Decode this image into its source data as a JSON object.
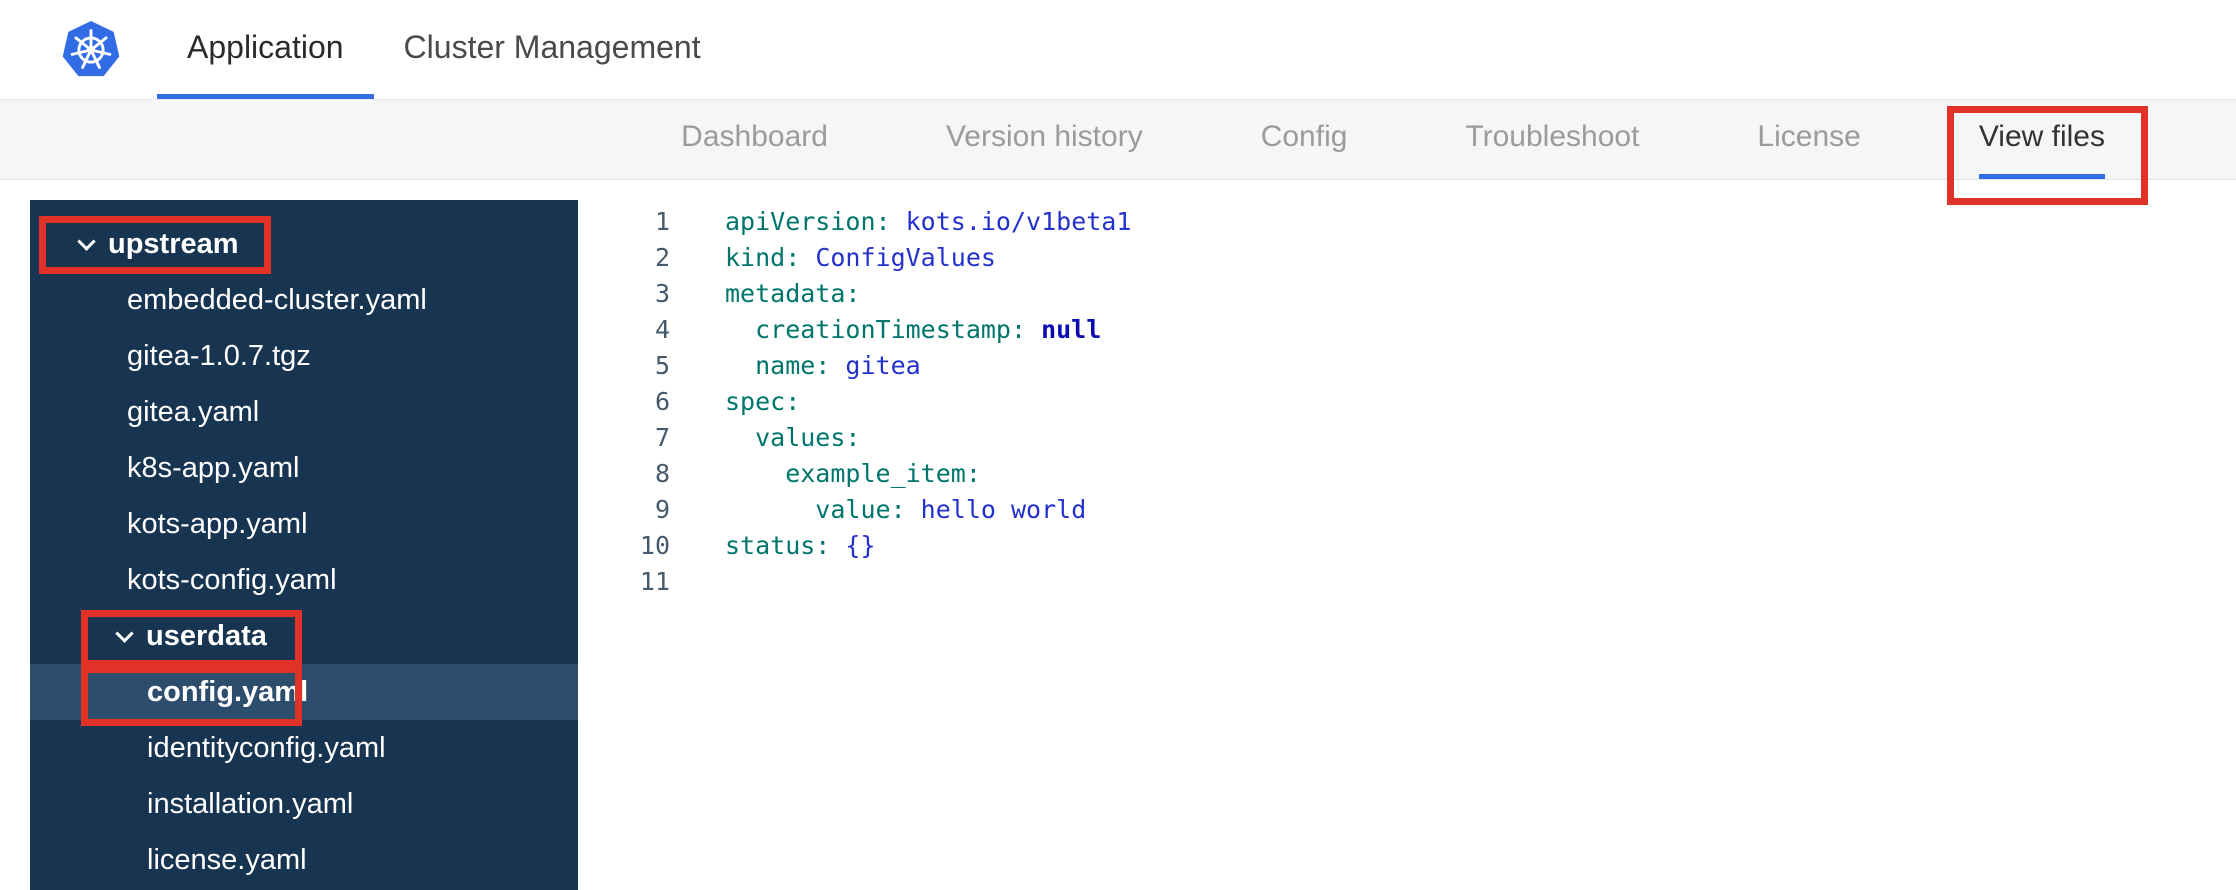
{
  "header": {
    "tabs": [
      {
        "label": "Application",
        "active": true
      },
      {
        "label": "Cluster Management",
        "active": false
      }
    ]
  },
  "subnav": {
    "tabs": [
      {
        "label": "Dashboard",
        "active": false
      },
      {
        "label": "Version history",
        "active": false
      },
      {
        "label": "Config",
        "active": false
      },
      {
        "label": "Troubleshoot",
        "active": false
      },
      {
        "label": "License",
        "active": false
      },
      {
        "label": "View files",
        "active": true,
        "annotated": true
      }
    ]
  },
  "file_tree": {
    "items": [
      {
        "type": "folder",
        "label": "upstream",
        "level": 0,
        "expanded": true,
        "annotated": true
      },
      {
        "type": "file",
        "label": "embedded-cluster.yaml",
        "level": 1
      },
      {
        "type": "file",
        "label": "gitea-1.0.7.tgz",
        "level": 1
      },
      {
        "type": "file",
        "label": "gitea.yaml",
        "level": 1
      },
      {
        "type": "file",
        "label": "k8s-app.yaml",
        "level": 1
      },
      {
        "type": "file",
        "label": "kots-app.yaml",
        "level": 1
      },
      {
        "type": "file",
        "label": "kots-config.yaml",
        "level": 1
      },
      {
        "type": "folder",
        "label": "userdata",
        "level": 1,
        "expanded": true,
        "annotated": true
      },
      {
        "type": "file",
        "label": "config.yaml",
        "level": 2,
        "selected": true,
        "annotated": true
      },
      {
        "type": "file",
        "label": "identityconfig.yaml",
        "level": 2
      },
      {
        "type": "file",
        "label": "installation.yaml",
        "level": 2
      },
      {
        "type": "file",
        "label": "license.yaml",
        "level": 2
      }
    ]
  },
  "editor": {
    "lines": [
      {
        "n": "1",
        "tokens": [
          {
            "c": "key",
            "t": "apiVersion:"
          },
          {
            "c": "val",
            "t": " kots.io/v1beta1"
          }
        ]
      },
      {
        "n": "2",
        "tokens": [
          {
            "c": "key",
            "t": "kind:"
          },
          {
            "c": "val",
            "t": " ConfigValues"
          }
        ]
      },
      {
        "n": "3",
        "tokens": [
          {
            "c": "key",
            "t": "metadata:"
          }
        ]
      },
      {
        "n": "4",
        "tokens": [
          {
            "c": "key",
            "t": "  creationTimestamp:"
          },
          {
            "c": "val-bold",
            "t": " null"
          }
        ]
      },
      {
        "n": "5",
        "tokens": [
          {
            "c": "key",
            "t": "  name:"
          },
          {
            "c": "val",
            "t": " gitea"
          }
        ]
      },
      {
        "n": "6",
        "tokens": [
          {
            "c": "key",
            "t": "spec:"
          }
        ]
      },
      {
        "n": "7",
        "tokens": [
          {
            "c": "key",
            "t": "  values:"
          }
        ]
      },
      {
        "n": "8",
        "tokens": [
          {
            "c": "key",
            "t": "    example_item:"
          }
        ]
      },
      {
        "n": "9",
        "tokens": [
          {
            "c": "key",
            "t": "      value:"
          },
          {
            "c": "val",
            "t": " hello world"
          }
        ]
      },
      {
        "n": "10",
        "tokens": [
          {
            "c": "key",
            "t": "status:"
          },
          {
            "c": "val",
            "t": " {}"
          }
        ]
      },
      {
        "n": "11",
        "tokens": []
      }
    ]
  },
  "annotations": {
    "color": "#e03226",
    "boxes": [
      "view-files-tab",
      "upstream-folder",
      "userdata-folder",
      "config-yaml-file"
    ]
  },
  "colors": {
    "accent_blue": "#326de6",
    "annotation_red": "#e03226",
    "sidebar_bg": "#173450",
    "sidebar_selected": "#2d4d6d",
    "code_key": "#00756b",
    "code_value": "#2431cc",
    "code_null": "#0b0bb3",
    "line_number": "#44596b",
    "subnav_bg": "#f5f6f7",
    "kubernetes_blue": "#326ce5"
  }
}
